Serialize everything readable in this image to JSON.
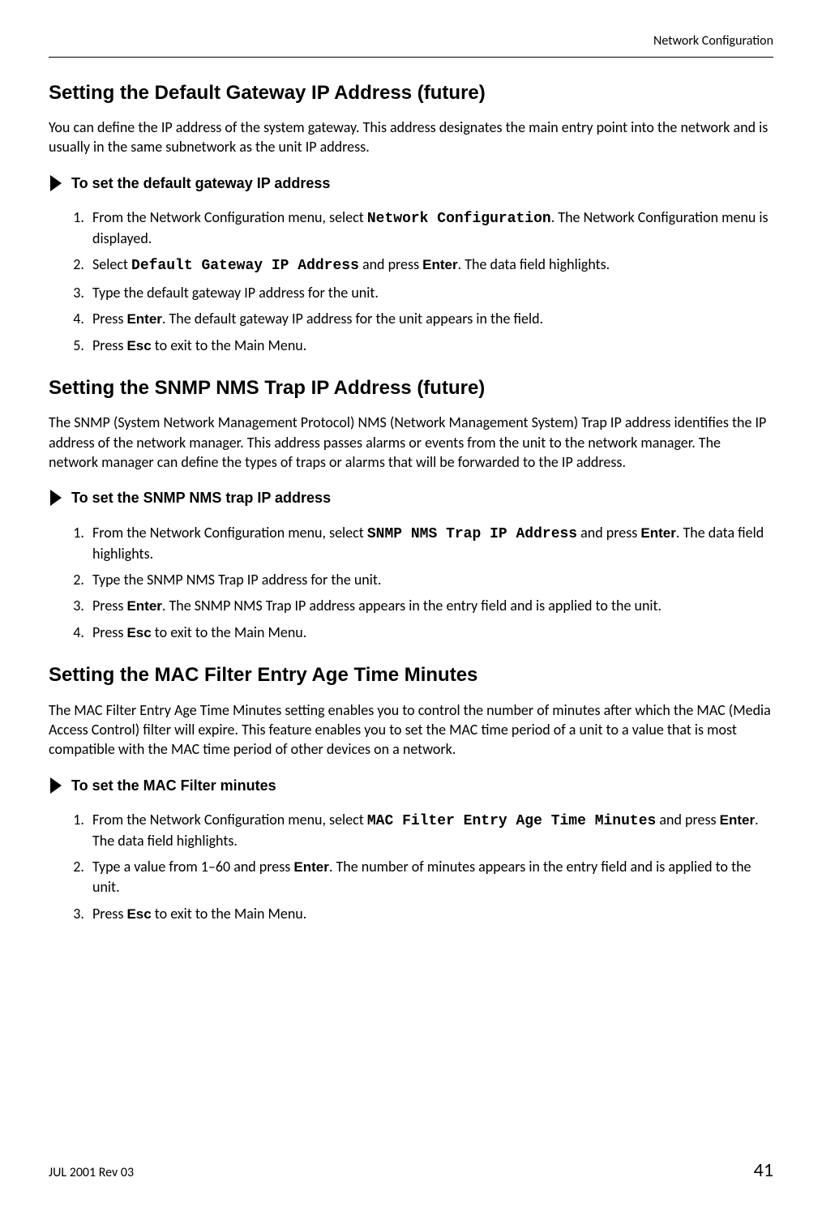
{
  "header": {
    "section": "Network Configuration"
  },
  "footer": {
    "rev": "JUL 2001 Rev 03",
    "page": "41"
  },
  "sec1": {
    "title": "Setting the Default Gateway IP Address (future)",
    "intro": "You can define the IP address of the system gateway. This address designates the main entry point into the network and is usually in the same subnetwork as the unit IP address.",
    "proc_label": "To set the default gateway IP address",
    "s1a": "From the Network Configuration menu, select ",
    "s1b": "Network Configuration",
    "s1c": ". The Network Configuration menu is displayed.",
    "s2a": "Select ",
    "s2b": "Default Gateway IP Address",
    "s2c": " and press ",
    "s2d": "Enter",
    "s2e": ". The data field highlights.",
    "s3": "Type the default gateway IP address for the unit.",
    "s4a": "Press ",
    "s4b": "Enter",
    "s4c": ". The default gateway IP address for the unit appears in the field.",
    "s5a": "Press ",
    "s5b": "Esc",
    "s5c": " to exit to the Main Menu."
  },
  "sec2": {
    "title": "Setting the SNMP NMS Trap IP Address (future)",
    "intro": "The SNMP (System Network Management Protocol) NMS (Network Management System) Trap IP address identifies the IP address of the network manager. This address passes alarms or events from the unit to the network manager. The network manager can define the types of traps or alarms that will be forwarded to the IP address.",
    "proc_label": "To set the SNMP NMS trap IP address",
    "s1a": "From the Network Configuration menu, select ",
    "s1b": "SNMP NMS Trap IP Address",
    "s1c": " and press ",
    "s1d": "Enter",
    "s1e": ". The data field highlights.",
    "s2": "Type the SNMP NMS Trap IP address for the unit.",
    "s3a": "Press ",
    "s3b": "Enter",
    "s3c": ". The SNMP NMS Trap IP address appears in the entry field and is applied to the unit.",
    "s4a": "Press ",
    "s4b": "Esc",
    "s4c": " to exit to the Main Menu."
  },
  "sec3": {
    "title": "Setting the MAC Filter Entry Age Time Minutes",
    "intro": "The MAC Filter Entry Age Time Minutes setting enables you to control the number of minutes after which the MAC (Media Access Control) filter will expire. This feature enables you to set the MAC time period of a unit to a value that is most compatible with the MAC time period of other devices on a network.",
    "proc_label": "To set the MAC Filter minutes",
    "s1a": "From the Network Configuration menu, select ",
    "s1b": "MAC Filter Entry Age Time Minutes",
    "s1c": " and press ",
    "s1d": "Enter",
    "s1e": ". The data field highlights.",
    "s2a": "Type a value from 1–60 and press ",
    "s2b": "Enter",
    "s2c": ". The number of minutes appears in the entry field and is applied to the unit.",
    "s3a": "Press ",
    "s3b": "Esc",
    "s3c": " to exit to the Main Menu."
  }
}
